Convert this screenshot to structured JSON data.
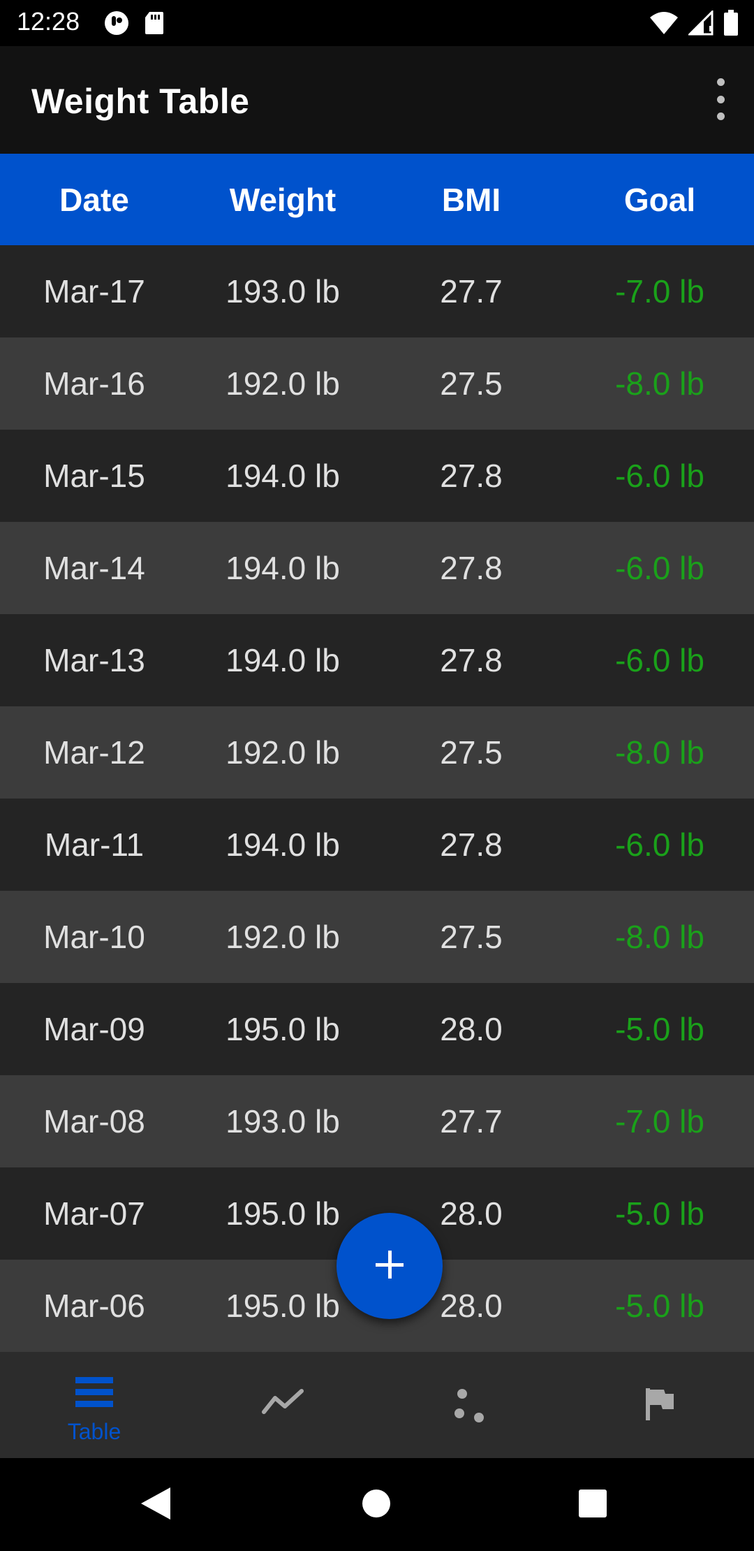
{
  "status_bar": {
    "time": "12:28",
    "icons_left": [
      "sim-toolkit-icon",
      "sd-card-icon"
    ],
    "icons_right": [
      "wifi-icon",
      "signal-icon",
      "battery-icon"
    ]
  },
  "app_bar": {
    "title": "Weight Table",
    "overflow_icon": "more-vert-icon"
  },
  "table": {
    "headers": [
      "Date",
      "Weight",
      "BMI",
      "Goal"
    ],
    "rows": [
      {
        "date": "Mar-17",
        "weight": "193.0 lb",
        "bmi": "27.7",
        "goal": "-7.0 lb"
      },
      {
        "date": "Mar-16",
        "weight": "192.0 lb",
        "bmi": "27.5",
        "goal": "-8.0 lb"
      },
      {
        "date": "Mar-15",
        "weight": "194.0 lb",
        "bmi": "27.8",
        "goal": "-6.0 lb"
      },
      {
        "date": "Mar-14",
        "weight": "194.0 lb",
        "bmi": "27.8",
        "goal": "-6.0 lb"
      },
      {
        "date": "Mar-13",
        "weight": "194.0 lb",
        "bmi": "27.8",
        "goal": "-6.0 lb"
      },
      {
        "date": "Mar-12",
        "weight": "192.0 lb",
        "bmi": "27.5",
        "goal": "-8.0 lb"
      },
      {
        "date": "Mar-11",
        "weight": "194.0 lb",
        "bmi": "27.8",
        "goal": "-6.0 lb"
      },
      {
        "date": "Mar-10",
        "weight": "192.0 lb",
        "bmi": "27.5",
        "goal": "-8.0 lb"
      },
      {
        "date": "Mar-09",
        "weight": "195.0 lb",
        "bmi": "28.0",
        "goal": "-5.0 lb"
      },
      {
        "date": "Mar-08",
        "weight": "193.0 lb",
        "bmi": "27.7",
        "goal": "-7.0 lb"
      },
      {
        "date": "Mar-07",
        "weight": "195.0 lb",
        "bmi": "28.0",
        "goal": "-5.0 lb"
      },
      {
        "date": "Mar-06",
        "weight": "195.0 lb",
        "bmi": "28.0",
        "goal": "-5.0 lb"
      }
    ]
  },
  "fab": {
    "icon": "add-icon"
  },
  "bottom_nav": {
    "items": [
      {
        "label": "Table",
        "icon": "table-list-icon",
        "active": true
      },
      {
        "label": "",
        "icon": "line-chart-icon",
        "active": false
      },
      {
        "label": "",
        "icon": "scatter-icon",
        "active": false
      },
      {
        "label": "",
        "icon": "flag-icon",
        "active": false
      }
    ]
  },
  "system_nav": {
    "icons": [
      "back-icon",
      "home-icon",
      "recents-icon"
    ]
  },
  "colors": {
    "accent": "#0052cc",
    "goal_green": "#1aa11a",
    "row_dark": "#242424",
    "row_light": "#3c3c3c",
    "app_bar": "#121212",
    "nav_bg": "#2c2c2c"
  }
}
